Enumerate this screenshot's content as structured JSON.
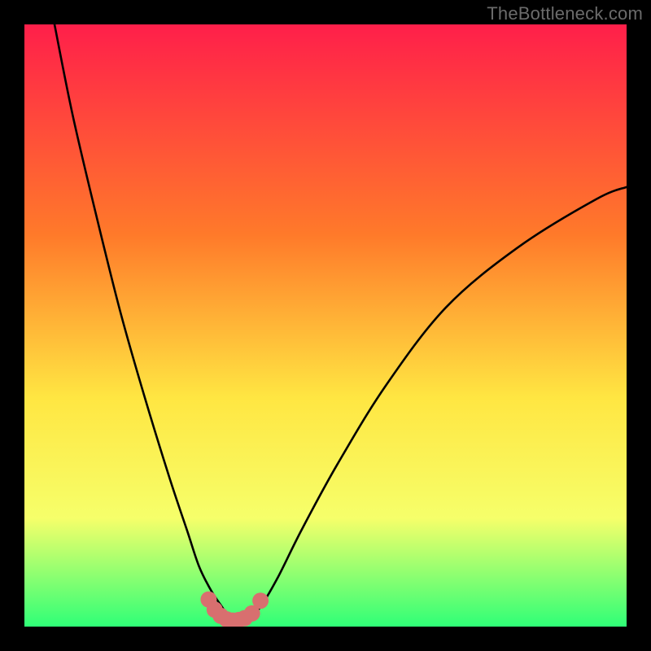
{
  "watermark": "TheBottleneck.com",
  "colors": {
    "frame": "#000000",
    "gradient_top": "#ff1f4a",
    "gradient_mid1": "#ff7a2a",
    "gradient_mid2": "#ffe642",
    "gradient_mid3": "#f6ff6a",
    "gradient_bottom": "#2fff77",
    "curve": "#000000",
    "marker_fill": "#d86f6f",
    "marker_stroke": "#c95a5a"
  },
  "chart_data": {
    "type": "line",
    "title": "",
    "xlabel": "",
    "ylabel": "",
    "xlim": [
      0,
      100
    ],
    "ylim": [
      0,
      100
    ],
    "grid": false,
    "legend": false,
    "series": [
      {
        "name": "bottleneck-curve",
        "x": [
          5,
          8,
          12,
          16,
          20,
          24,
          27,
          29,
          31,
          33,
          34,
          35.5,
          37,
          39,
          42,
          46,
          52,
          60,
          70,
          82,
          95,
          100
        ],
        "y": [
          100,
          85,
          68,
          52,
          38,
          25,
          16,
          10,
          6,
          3,
          1.5,
          0.8,
          1.2,
          3,
          8,
          16,
          27,
          40,
          53,
          63,
          71,
          73
        ]
      }
    ],
    "markers": {
      "name": "valley-dots",
      "x": [
        30.6,
        31.6,
        32.6,
        33.6,
        34.6,
        35.6,
        36.6,
        37.8,
        39.2
      ],
      "y": [
        4.5,
        2.8,
        1.8,
        1.2,
        1.0,
        1.1,
        1.4,
        2.2,
        4.3
      ]
    }
  }
}
